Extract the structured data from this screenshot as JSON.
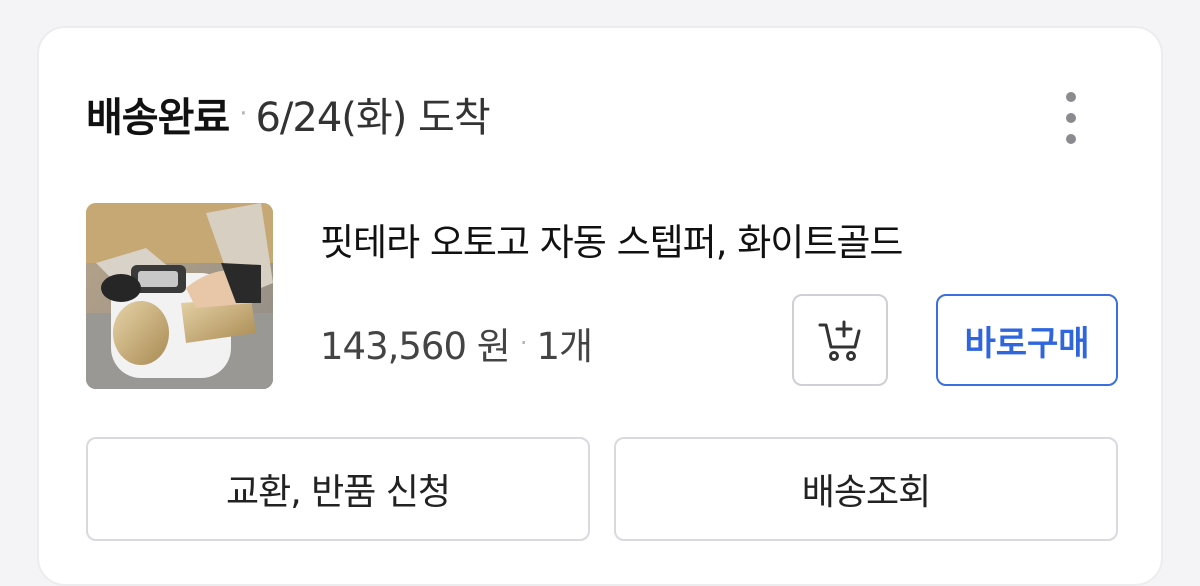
{
  "order": {
    "status": "배송완료",
    "separator": "·",
    "arrival": "6/24(화) 도착"
  },
  "product": {
    "name": "핏테라 오토고 자동 스텝퍼, 화이트골드",
    "price": "143,560 원",
    "separator": "·",
    "quantity": "1개",
    "image_icon": "foot-stepper-product-image"
  },
  "buttons": {
    "more_icon": "more-vertical-icon",
    "cart_icon": "add-to-cart-icon",
    "buy_now": "바로구매",
    "exchange_return": "교환, 반품 신청",
    "track_delivery": "배송조회"
  },
  "colors": {
    "accent": "#2f66de",
    "status_text": "#111111"
  }
}
